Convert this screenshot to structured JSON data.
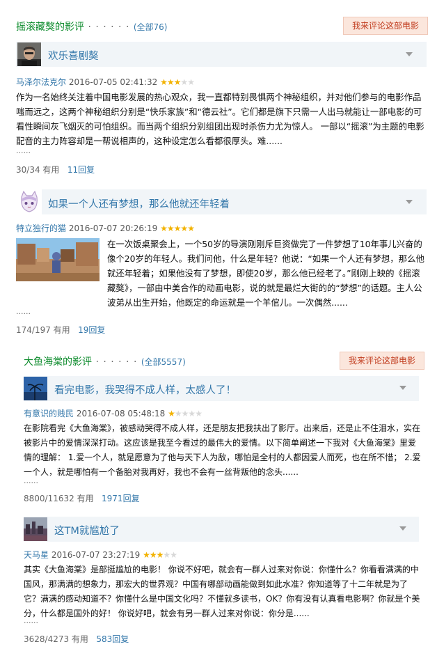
{
  "section1": {
    "title": "摇滚藏獒的影评",
    "dots": " · · · · · · ",
    "count": "(全部76)",
    "write_button": "我来评论这部电影",
    "reviews": [
      {
        "title": "欢乐喜剧獒",
        "author": "马泽尔法克尔",
        "date": "2016-07-05 02:41:32",
        "rating": 3,
        "text": "作为一名始终关注着中国电影发展的热心观众，我一直都特别畏惧两个神秘组织，并对他们参与的电影作品嗤而远之，这两个神秘组织分别是“快乐家族”和“德云社”。它们都是旗下只需一人出马就能让一部电影的可看性瞬间灰飞烟灭的可怕组织。而当两个组织分别组团出现时杀伤力尤为惊人。 一部以“摇滚”为主题的电影配音的主力阵容却是一帮说相声的，这种设定怎么看都很厚头。难......",
        "more": "......",
        "useful": "30/34 有用",
        "replies": "11回复"
      },
      {
        "title": "如果一个人还有梦想，那么他就还年轻着",
        "author": "特立独行的猫",
        "date": "2016-07-07 20:26:19",
        "rating": 5,
        "text": "在一次饭桌聚会上，一个50岁的导演刚刚斥巨资做完了一件梦想了10年事儿兴奋的像个20岁的年轻人。我们问他，什么是年轻？他说：“如果一个人还有梦想，那么他就还年轻着；如果他没有了梦想，即使20岁，那么他已经老了。”刚刚上映的《摇滚藏獒》，一部由中美合作的动画电影，说的就是最烂大街的的“梦想”的话题。主人公波弟从出生开始，他既定的命运就是一个羊倌儿。一次偶然......",
        "more": "......",
        "useful": "174/197 有用",
        "replies": "19回复"
      }
    ]
  },
  "section2": {
    "title": "大鱼海棠的影评",
    "dots": " · · · · · · ",
    "count": "(全部5557)",
    "write_button": "我来评论这部电影",
    "reviews": [
      {
        "title": "看完电影，我哭得不成人样，太感人了！",
        "author": "有意识的贱民",
        "date": "2016-07-08 05:48:18",
        "rating": 1,
        "text": "在影院看完《大鱼海棠》，被感动哭得不成人样，还是朋友把我扶出了影厅。出来后，还是止不住泪水，实在被影片中的爱情深深打动。这应该是我至今看过的最伟大的爱情。以下简单阐述一下我对《大鱼海棠》里爱情的理解：  1.爱一个人，就是愿意为了他与天下人为敌，哪怕是全村的人都因爱人而死，也在所不惜；  2.爱一个人，就是哪怕有一个备胎对我再好，我也不会有一丝背叛他的念头......",
        "more": "......",
        "useful": "8800/11632 有用",
        "replies": "1971回复"
      },
      {
        "title": "这TM就尴尬了",
        "author": "天马星",
        "date": "2016-07-07 23:27:19",
        "rating": 3,
        "text": "其实《大鱼海棠》是部挺尴尬的电影！ 你说不好吧，就会有一群人过来对你说：你懂什么？你看看满满的中国风，那满满的想象力，那宏大的世界观？中国有哪部动画能做到如此水准？你知道等了十二年就是为了它？满满的感动知道不？你懂什么是中国文化吗？不懂就多读书，OK？你有没有认真看电影啊？你就是个美分，什么都是国外的好！ 你说好吧，就会有另一群人过来对你说：你分是......",
        "more": "......",
        "useful": "3628/4273 有用",
        "replies": "583回复"
      }
    ]
  },
  "colors": {
    "green": "#0a8a2a",
    "link": "#3377aa",
    "star": "#f2b200",
    "bar": "#f1f5f8"
  },
  "icons": [
    "avatar-man-icon",
    "avatar-cat-girl-icon",
    "avatar-sky-icon",
    "avatar-city-icon",
    "collapse-arrow-icon",
    "star-icon"
  ]
}
